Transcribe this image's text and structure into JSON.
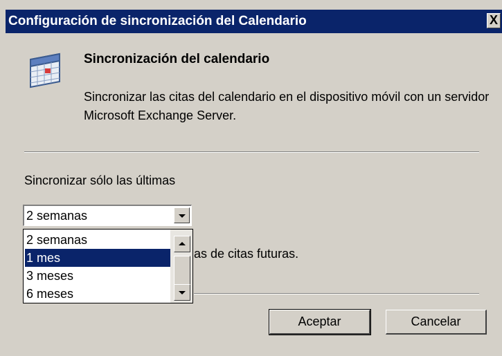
{
  "window": {
    "title": "Configuración de sincronización del Calendario",
    "close_label": "X"
  },
  "header": {
    "icon": "calendar-icon",
    "title": "Sincronización del calendario",
    "description": "Sincronizar las citas del calendario en el dispositivo móvil con un servidor Microsoft Exchange Server."
  },
  "sync": {
    "label": "Sincronizar sólo las últimas",
    "selected": "2 semanas",
    "options": [
      "2 semanas",
      "1 mes",
      "3 meses",
      "6 meses"
    ],
    "highlighted": "1 mes",
    "partial_text": "as de citas futuras."
  },
  "buttons": {
    "ok": "Aceptar",
    "cancel": "Cancelar"
  },
  "colors": {
    "titlebar": "#0a246a",
    "dialog": "#d4d0c8",
    "selection": "#0a246a"
  }
}
